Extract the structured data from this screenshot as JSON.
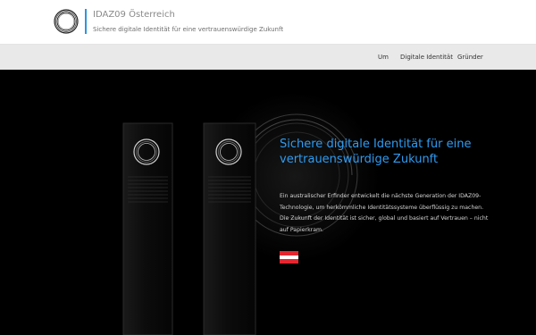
{
  "site": {
    "title": "IDAZ09 Österreich",
    "tagline": "Sichere digitale Identität für eine vertrauenswürdige Zukunft"
  },
  "nav": {
    "items": [
      {
        "label": "Um"
      },
      {
        "label": "Digitale Identität"
      },
      {
        "label": "Gründer"
      }
    ]
  },
  "hero": {
    "title": "Sichere digitale Identität für eine vertrauenswürdige Zukunft",
    "text": "Ein australischer Erfinder entwickelt die nächste Generation der IDAZ09-Technologie, um herkömmliche Identitätssysteme überflüssig zu machen. Die Zukunft der Identität ist sicher, global und basiert auf Vertrauen – nicht auf Papierkram.",
    "flag": "austria-flag-icon"
  },
  "colors": {
    "accent": "#2f9cf2",
    "brand_bar": "#2e95e0",
    "navbar_bg": "#e9e9e9",
    "hero_bg": "#000000",
    "flag_red": "#e6262f"
  }
}
